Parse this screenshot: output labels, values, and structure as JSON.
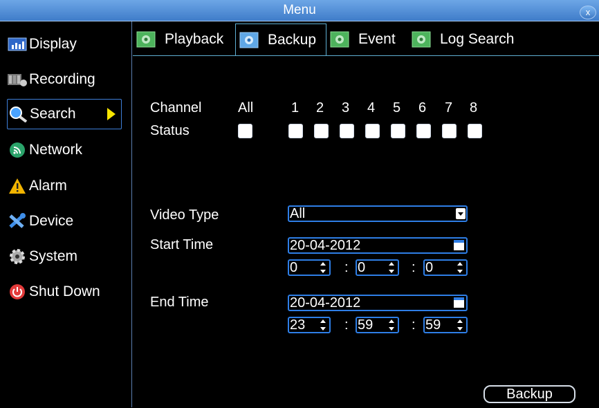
{
  "window": {
    "title": "Menu",
    "close_label": "x"
  },
  "sidebar": {
    "items": [
      {
        "label": "Display",
        "icon": "display-icon"
      },
      {
        "label": "Recording",
        "icon": "recording-icon"
      },
      {
        "label": "Search",
        "icon": "search-icon",
        "active": true
      },
      {
        "label": "Network",
        "icon": "network-icon"
      },
      {
        "label": "Alarm",
        "icon": "alarm-icon"
      },
      {
        "label": "Device",
        "icon": "device-icon"
      },
      {
        "label": "System",
        "icon": "system-icon"
      },
      {
        "label": "Shut Down",
        "icon": "power-icon"
      }
    ]
  },
  "tabs": [
    {
      "label": "Playback"
    },
    {
      "label": "Backup",
      "active": true
    },
    {
      "label": "Event"
    },
    {
      "label": "Log Search"
    }
  ],
  "backup": {
    "channel_label": "Channel",
    "status_label": "Status",
    "all_label": "All",
    "channels": [
      "1",
      "2",
      "3",
      "4",
      "5",
      "6",
      "7",
      "8"
    ],
    "video_type_label": "Video Type",
    "video_type_value": "All",
    "start_time_label": "Start Time",
    "start_date": "20-04-2012",
    "start_h": "0",
    "start_m": "0",
    "start_s": "0",
    "end_time_label": "End Time",
    "end_date": "20-04-2012",
    "end_h": "23",
    "end_m": "59",
    "end_s": "59",
    "colon": ":",
    "backup_button": "Backup"
  },
  "colors": {
    "accent": "#2e7ee6",
    "title_bar": "#4f8fd8",
    "arrow": "#f7e500"
  }
}
